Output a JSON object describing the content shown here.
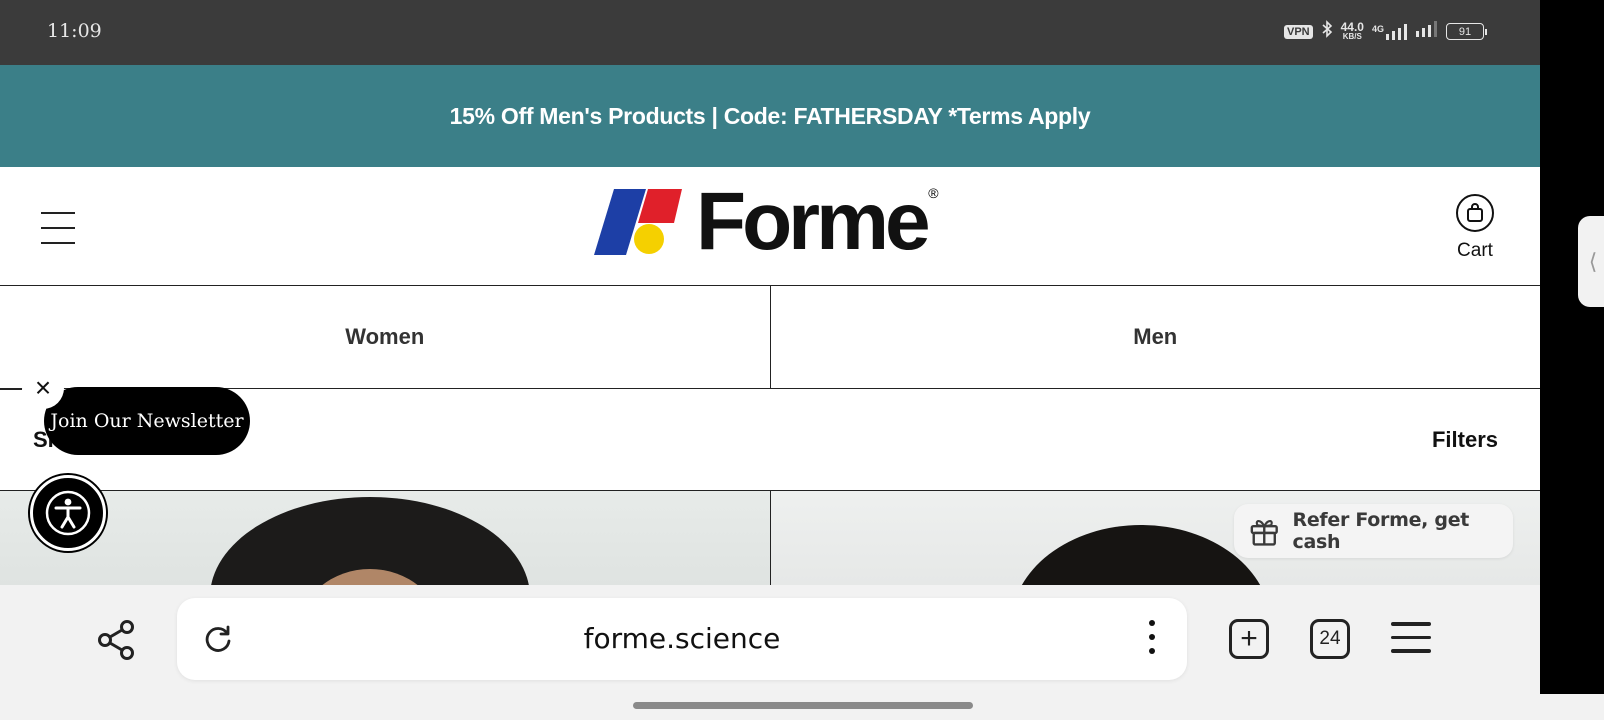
{
  "status_bar": {
    "time": "11:09",
    "vpn": "VPN",
    "speed_value": "44.0",
    "speed_unit": "KB/S",
    "network": "4G",
    "battery": "91"
  },
  "promo": {
    "text": "15% Off Men's Products | Code: FATHERSDAY *Terms Apply"
  },
  "header": {
    "logo_text": "Forme",
    "logo_reg": "®",
    "cart_label": "Cart"
  },
  "categories": [
    {
      "label": "Women"
    },
    {
      "label": "Men"
    }
  ],
  "filter_row": {
    "sort_label": "Sh",
    "filters_label": "Filters"
  },
  "newsletter": {
    "close_glyph": "×",
    "label": "Join Our Newsletter"
  },
  "refer": {
    "label": "Refer Forme, get cash"
  },
  "browser": {
    "url": "forme.science",
    "tab_count": "24",
    "new_tab_glyph": "+"
  },
  "side_handle_glyph": "⟨",
  "colors": {
    "promo_bg": "#3b7f88",
    "logo_blue": "#1d3fa6",
    "logo_red": "#e0202a",
    "logo_yellow": "#f5d000"
  }
}
